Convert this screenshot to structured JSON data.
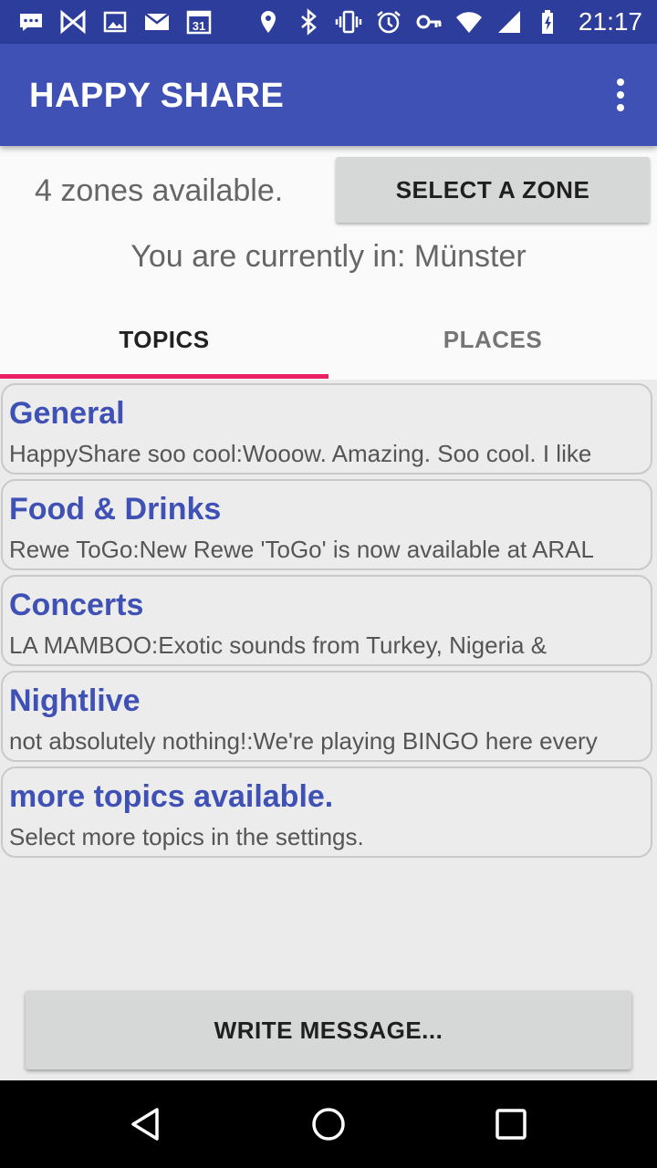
{
  "status_bar": {
    "time": "21:17",
    "left_icons": [
      "chat-icon",
      "bowtie-icon",
      "image-icon",
      "mail-icon",
      "calendar-icon"
    ],
    "calendar_day": "31",
    "right_icons": [
      "location-icon",
      "bluetooth-icon",
      "vibrate-icon",
      "alarm-icon",
      "key-icon",
      "wifi-icon",
      "signal-icon",
      "battery-charging-icon"
    ]
  },
  "app_bar": {
    "title": "HAPPY SHARE",
    "overflow_icon": "more-vert-icon"
  },
  "zone": {
    "available_text": "4 zones available.",
    "select_button": "SELECT A ZONE",
    "current_text": "You are currently in: Münster"
  },
  "tabs": [
    {
      "label": "TOPICS",
      "selected": true
    },
    {
      "label": "PLACES",
      "selected": false
    }
  ],
  "topics": [
    {
      "title": "General",
      "preview": "HappyShare soo cool:Wooow. Amazing. Soo cool. I like"
    },
    {
      "title": "Food & Drinks",
      "preview": "Rewe ToGo:New Rewe 'ToGo' is now available at ARAL"
    },
    {
      "title": "Concerts",
      "preview": "LA MAMBOO:Exotic sounds from Turkey, Nigeria &"
    },
    {
      "title": "Nightlive",
      "preview": "not absolutely nothing!:We're playing BINGO here every"
    },
    {
      "title": "more topics available.",
      "preview": "Select more topics in the settings."
    }
  ],
  "actions": {
    "write_message": "WRITE MESSAGE..."
  },
  "colors": {
    "status_bar": "#2d3d9b",
    "app_bar": "#3f51b5",
    "accent": "#e91e63",
    "topic_title": "#3f51b5"
  }
}
